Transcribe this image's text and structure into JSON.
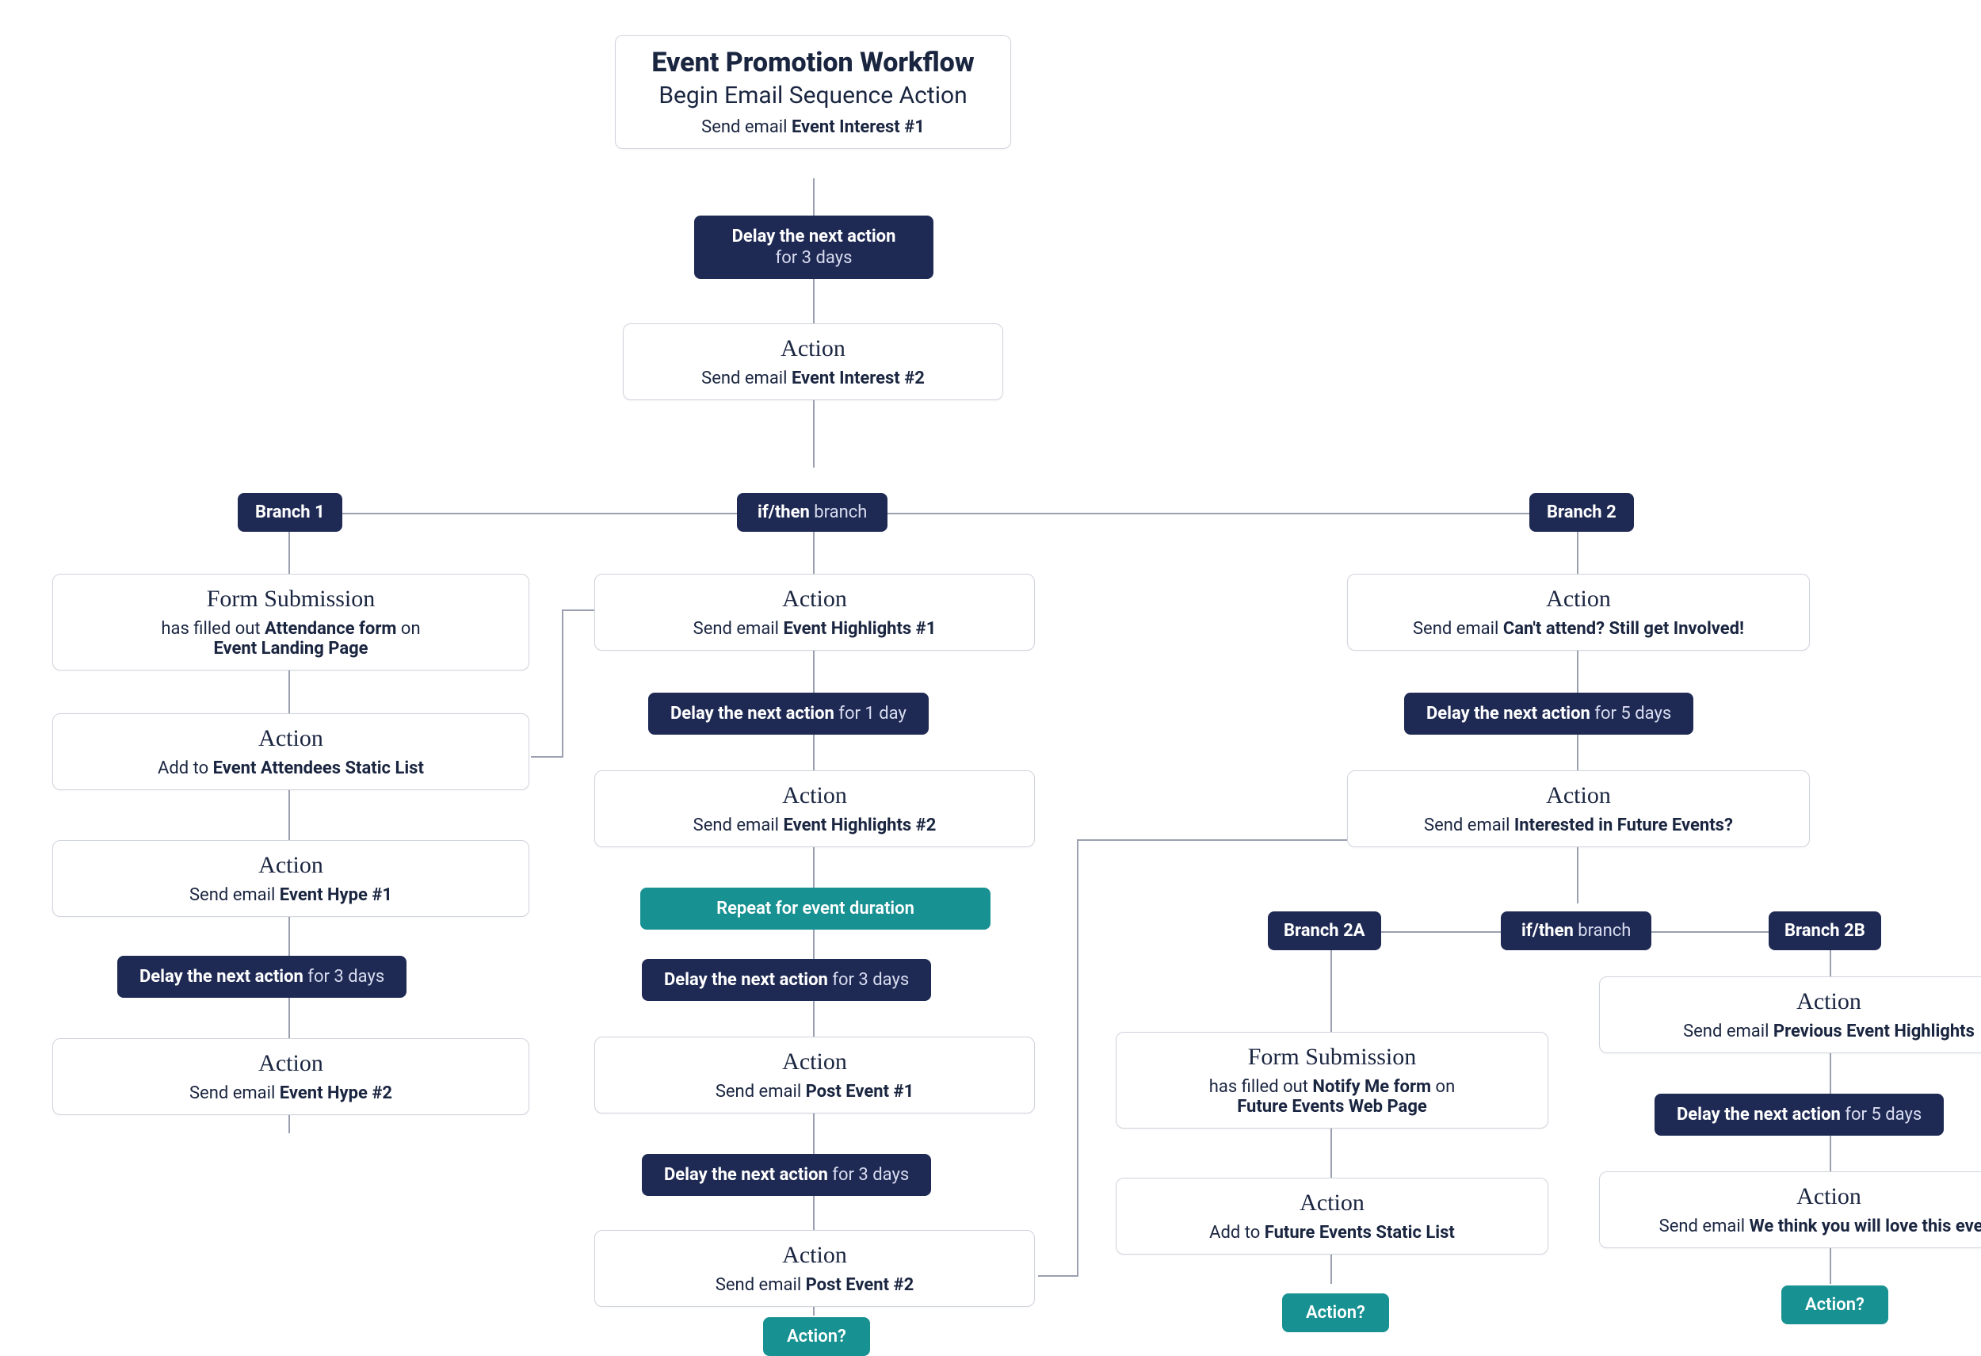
{
  "root": {
    "title": "Event Promotion Workflow",
    "subtitle": "Begin Email Sequence Action",
    "line_a": "Send email ",
    "line_b": "Event Interest #1"
  },
  "d1": {
    "a": "Delay the next action",
    "b": " for 3 days"
  },
  "n_action2": {
    "title": "Action",
    "a": "Send email ",
    "b": "Event Interest #2"
  },
  "ifthen": {
    "a": "if/then",
    "b": " branch"
  },
  "branch1": "Branch 1",
  "branch2": "Branch 2",
  "b1_form": {
    "title": "Form Submission",
    "a": "has filled out ",
    "b": "Attendance form",
    "c": " on",
    "d": "Event Landing Page"
  },
  "b1_add": {
    "title": "Action",
    "a": "Add to ",
    "b": "Event Attendees Static List"
  },
  "b1_hype1": {
    "title": "Action",
    "a": "Send email ",
    "b": "Event Hype #1"
  },
  "b1_delay": {
    "a": "Delay the next action",
    "b": " for 3 days"
  },
  "b1_hype2": {
    "title": "Action",
    "a": "Send email ",
    "b": "Event Hype #2"
  },
  "mid_h1": {
    "title": "Action",
    "a": "Send email ",
    "b": "Event Highlights #1"
  },
  "mid_d1": {
    "a": "Delay the next action",
    "b": " for 1 day"
  },
  "mid_h2": {
    "title": "Action",
    "a": "Send email ",
    "b": "Event Highlights #2"
  },
  "mid_repeat": "Repeat for event duration",
  "mid_d2": {
    "a": "Delay the next action",
    "b": " for 3 days"
  },
  "mid_p1": {
    "title": "Action",
    "a": "Send email ",
    "b": "Post Event #1"
  },
  "mid_d3": {
    "a": "Delay the next action",
    "b": " for 3 days"
  },
  "mid_p2": {
    "title": "Action",
    "a": "Send email ",
    "b": "Post Event #2"
  },
  "mid_actionq": "Action?",
  "b2_cant": {
    "title": "Action",
    "a": "Send email ",
    "b": "Can't attend? Still get Involved!"
  },
  "b2_d1": {
    "a": "Delay the next action",
    "b": " for 5 days"
  },
  "b2_future": {
    "title": "Action",
    "a": "Send email ",
    "b": "Interested in Future Events?"
  },
  "ifthen2": {
    "a": "if/then",
    "b": " branch"
  },
  "branch2a": "Branch 2A",
  "branch2b": "Branch 2B",
  "b2a_form": {
    "title": "Form Submission",
    "a": "has filled out ",
    "b": "Notify Me form",
    "c": " on",
    "d": "Future Events Web Page"
  },
  "b2a_add": {
    "title": "Action",
    "a": "Add to ",
    "b": "Future Events Static List"
  },
  "b2a_actionq": "Action?",
  "b2b_prev": {
    "title": "Action",
    "a": "Send email ",
    "b": "Previous Event Highlights"
  },
  "b2b_d": {
    "a": "Delay the next action",
    "b": " for 5 days"
  },
  "b2b_love": {
    "title": "Action",
    "a": "Send email ",
    "b": "We think you will love this event"
  },
  "b2b_actionq": "Action?"
}
